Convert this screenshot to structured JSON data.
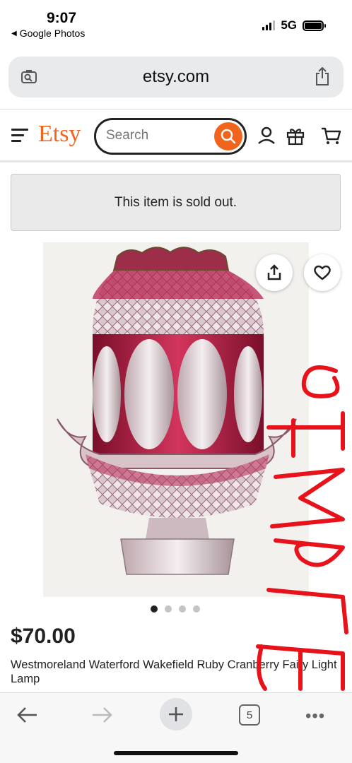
{
  "status_bar": {
    "time": "9:07",
    "back_label": "Google Photos",
    "network": "5G"
  },
  "browser": {
    "url": "etsy.com",
    "tab_count": "5"
  },
  "header": {
    "logo": "Etsy",
    "search_placeholder": "Search"
  },
  "banner": {
    "text": "This item is sold out."
  },
  "product": {
    "price": "$70.00",
    "title": "Westmoreland Waterford Wakefield Ruby Cranberry Fairy Light Lamp",
    "image_count": 4,
    "active_image": 1,
    "handwritten_overlay": "SAMPLE"
  },
  "colors": {
    "brand": "#f1641e",
    "overlay_red": "#e8121a",
    "banner_bg": "#eaeaea"
  }
}
